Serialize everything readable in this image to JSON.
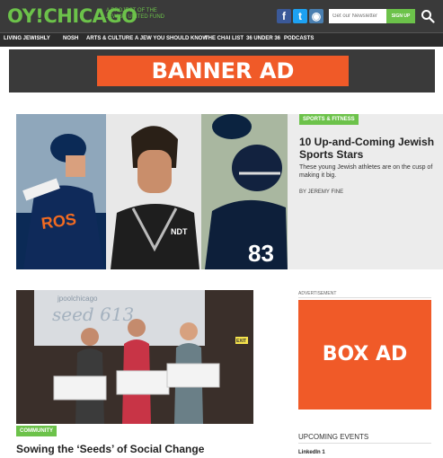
{
  "header": {
    "logo_oy": "OY!",
    "logo_chicago": "CHICAGO",
    "tagline": "A PROJECT OF THE JEWISH UNITED FUND",
    "newsletter_placeholder": "Get our Newsletter",
    "signup_label": "SIGN UP",
    "social": {
      "facebook": "f",
      "twitter": "t",
      "instagram": "◉"
    }
  },
  "nav": {
    "items": [
      "LIVING JEWISHLY",
      "NOSH",
      "ARTS & CULTURE",
      "A JEW YOU SHOULD KNOW",
      "THE CHAI LIST",
      "36 UNDER 36",
      "PODCASTS"
    ]
  },
  "banner": {
    "label": "BANNER AD"
  },
  "feature": {
    "category": "SPORTS & FITNESS",
    "title": "10 Up-and-Coming Jewish Sports Stars",
    "description": "These young Jewish athletes are on the cusp of making it big.",
    "byline": "BY JEREMY FINE",
    "photo_text": {
      "jersey_team": "ROS",
      "shirt_logo": "NDT",
      "helmet_number": "83"
    }
  },
  "story2": {
    "category": "COMMUNITY",
    "title": "Sowing the ‘Seeds’ of Social Change",
    "photo_text": {
      "screen_brand": "jpoolchicago",
      "screen_word": "seed 613",
      "exit_sign": "EXIT"
    }
  },
  "sidebar": {
    "advertisement_label": "ADVERTISEMENT",
    "box_ad": "BOX AD",
    "events_title": "UPCOMING EVENTS",
    "events": [
      "LinkedIn 1"
    ]
  },
  "colors": {
    "brand_green": "#6cc24a",
    "ad_orange": "#f05a28",
    "header_dark": "#3a3a3a"
  }
}
